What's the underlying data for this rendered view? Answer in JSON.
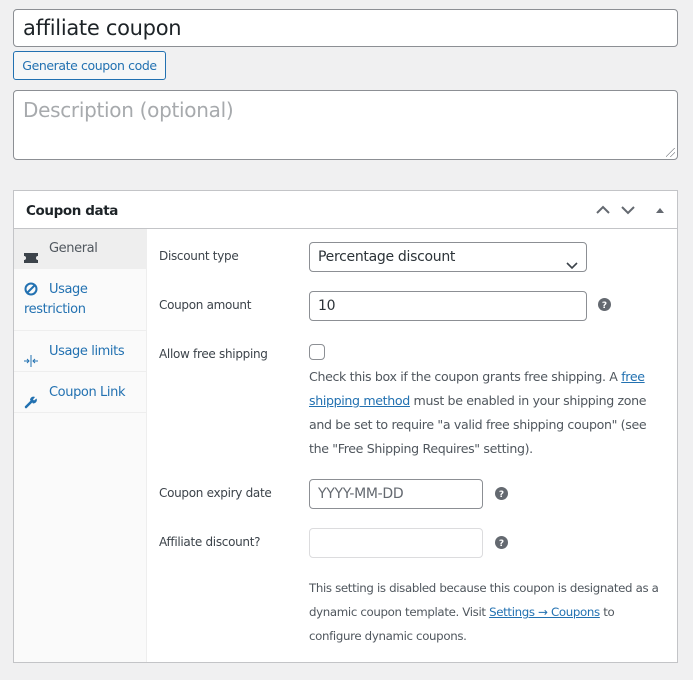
{
  "coupon_code": {
    "value": "affiliate coupon"
  },
  "generate_button": {
    "label": "Generate coupon code"
  },
  "description": {
    "placeholder": "Description (optional)",
    "value": ""
  },
  "panel": {
    "title": "Coupon data",
    "controls": {
      "move_up": "chevron-up-icon",
      "move_down": "chevron-down-icon",
      "toggle": "triangle-up-icon"
    }
  },
  "tabs": [
    {
      "label": "General",
      "icon": "ticket-icon",
      "active": true
    },
    {
      "label": "Usage restriction",
      "icon": "no-entry-icon",
      "active": false
    },
    {
      "label": "Usage limits",
      "icon": "arrows-in-icon",
      "active": false
    },
    {
      "label": "Coupon Link",
      "icon": "wrench-icon",
      "active": false
    }
  ],
  "general": {
    "discount_type": {
      "label": "Discount type",
      "value": "Percentage discount"
    },
    "coupon_amount": {
      "label": "Coupon amount",
      "value": "10"
    },
    "free_shipping": {
      "label": "Allow free shipping",
      "checked": false,
      "desc_before": "Check this box if the coupon grants free shipping. A ",
      "link_text": "free shipping method",
      "desc_after": " must be enabled in your shipping zone and be set to require \"a valid free shipping coupon\" (see the \"Free Shipping Requires\" setting)."
    },
    "expiry_date": {
      "label": "Coupon expiry date",
      "placeholder": "YYYY-MM-DD",
      "value": ""
    },
    "affiliate_discount": {
      "label": "Affiliate discount?",
      "value": "",
      "desc_before": "This setting is disabled because this coupon is designated as a dynamic coupon template. Visit ",
      "link_text": "Settings → Coupons",
      "desc_after": " to configure dynamic coupons."
    }
  },
  "colors": {
    "accent": "#2271b1",
    "background": "#f0f0f1",
    "border": "#c3c4c7"
  }
}
